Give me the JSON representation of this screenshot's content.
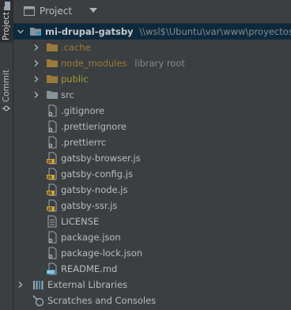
{
  "side_strip": {
    "project_tab": "Project",
    "commit_tab": "Commit"
  },
  "header": {
    "title": "Project"
  },
  "tree": {
    "root": {
      "name": "mi-drupal-gatsby",
      "path": "\\\\wsl$\\Ubuntu\\var\\www\\proyectos\\for"
    },
    "folders": [
      {
        "name": ".cache",
        "hint": ""
      },
      {
        "name": "node_modules",
        "hint": "library root"
      },
      {
        "name": "public",
        "hint": ""
      },
      {
        "name": "src",
        "hint": ""
      }
    ],
    "files": [
      {
        "name": ".gitignore",
        "type": "config"
      },
      {
        "name": ".prettierignore",
        "type": "config"
      },
      {
        "name": ".prettierrc",
        "type": "config"
      },
      {
        "name": "gatsby-browser.js",
        "type": "js"
      },
      {
        "name": "gatsby-config.js",
        "type": "js"
      },
      {
        "name": "gatsby-node.js",
        "type": "js"
      },
      {
        "name": "gatsby-ssr.js",
        "type": "js"
      },
      {
        "name": "LICENSE",
        "type": "text"
      },
      {
        "name": "package.json",
        "type": "json"
      },
      {
        "name": "package-lock.json",
        "type": "json"
      },
      {
        "name": "README.md",
        "type": "md"
      }
    ],
    "external_libraries": "External Libraries",
    "scratches": "Scratches and Consoles"
  },
  "colors": {
    "background": "#3c3f41",
    "selection": "#0d293e",
    "folder": "#87939a",
    "excluded_folder": "#9c7a3a",
    "js_badge": "#d8a53a"
  }
}
